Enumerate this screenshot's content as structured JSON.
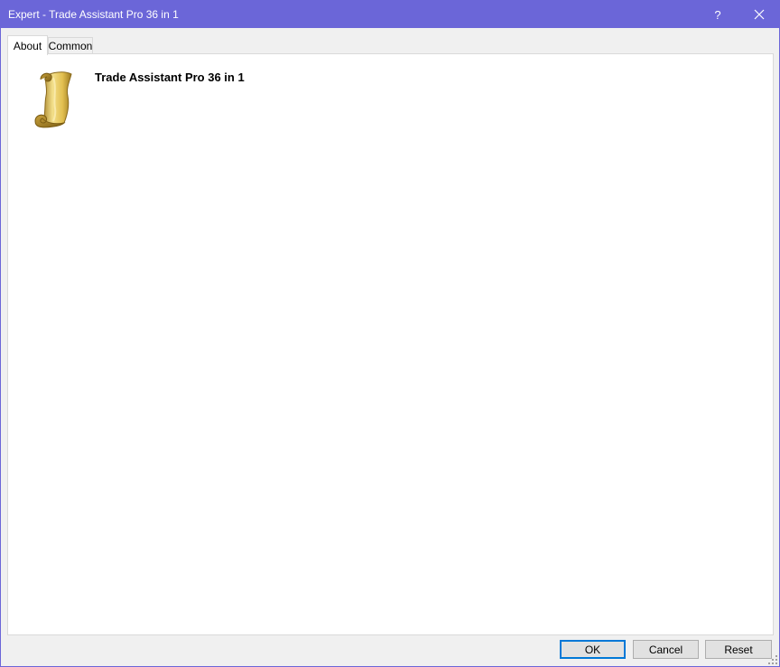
{
  "window": {
    "title": "Expert - Trade Assistant Pro 36 in 1",
    "help_label": "?"
  },
  "tabs": [
    {
      "label": "About",
      "active": true
    },
    {
      "label": "Common",
      "active": false
    }
  ],
  "about": {
    "icon": "scroll-icon",
    "expert_name": "Trade Assistant Pro 36 in 1"
  },
  "buttons": {
    "ok": "OK",
    "cancel": "Cancel",
    "reset": "Reset"
  },
  "colors": {
    "titlebar": "#6b66d8",
    "accent": "#0078d7"
  }
}
